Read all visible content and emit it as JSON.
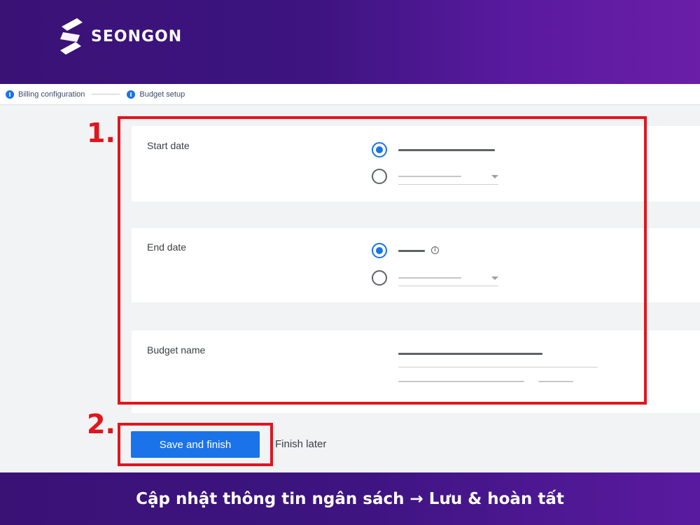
{
  "brand": {
    "name": "SEONGON",
    "icon": "seongon-logo-icon"
  },
  "stepper": {
    "steps": [
      {
        "label": "Billing configuration",
        "icon": "step-info-icon"
      },
      {
        "label": "Budget setup",
        "icon": "step-info-icon"
      }
    ]
  },
  "form": {
    "start_date": {
      "label": "Start date"
    },
    "end_date": {
      "label": "End date",
      "info_icon": "info-icon"
    },
    "budget_name": {
      "label": "Budget name"
    }
  },
  "actions": {
    "save_label": "Save and finish",
    "later_label": "Finish later"
  },
  "annotations": {
    "step1": "1.",
    "step2": "2."
  },
  "caption": "Cập nhật thông tin ngân sách → Lưu & hoàn tất",
  "colors": {
    "highlight": "#e0161e",
    "primary": "#1a73e8",
    "banner": "#3d1480"
  }
}
